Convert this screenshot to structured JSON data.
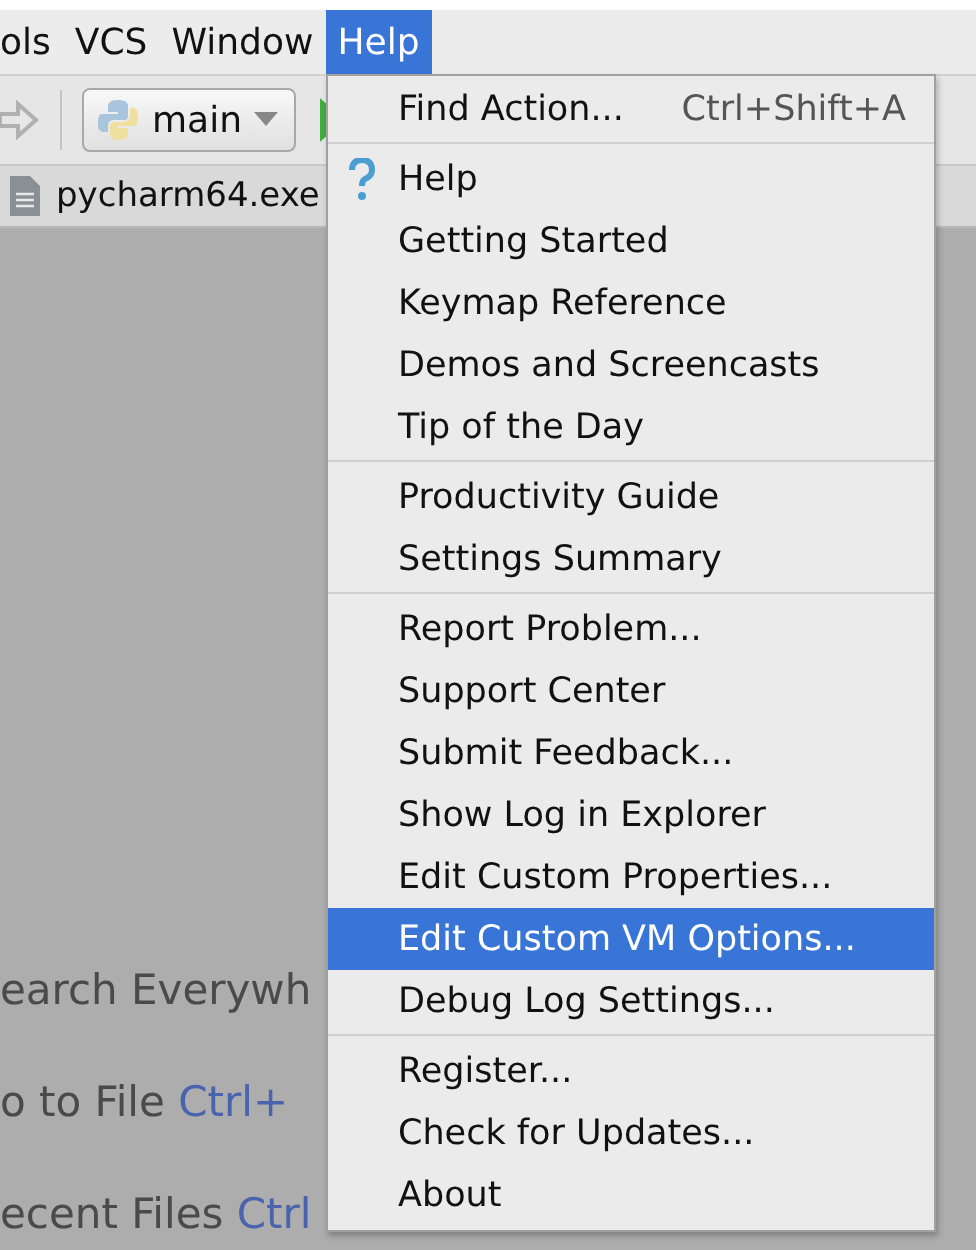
{
  "menu_bar": [
    {
      "label": "ols",
      "selected": false
    },
    {
      "label": "VCS",
      "selected": false
    },
    {
      "label": "Window",
      "selected": false
    },
    {
      "label": "Help",
      "selected": true
    }
  ],
  "toolbar": {
    "configuration": "main"
  },
  "editor_tab": {
    "label": "pycharm64.exe"
  },
  "editor_hints": [
    {
      "label": "earch Everywh"
    },
    {
      "label": "o to File",
      "shortcut": "Ctrl+"
    },
    {
      "label": "ecent Files",
      "shortcut": "Ctrl"
    }
  ],
  "help_menu": {
    "groups": [
      [
        {
          "kind": "plain",
          "label": "Find Action...",
          "shortcut": "Ctrl+Shift+A",
          "selected": false
        }
      ],
      [
        {
          "kind": "help",
          "label": "Help",
          "selected": false
        },
        {
          "kind": "plain",
          "label": "Getting Started",
          "selected": false
        },
        {
          "kind": "plain",
          "label": "Keymap Reference",
          "selected": false
        },
        {
          "kind": "plain",
          "label": "Demos and Screencasts",
          "selected": false
        },
        {
          "kind": "plain",
          "label": "Tip of the Day",
          "selected": false
        }
      ],
      [
        {
          "kind": "plain",
          "label": "Productivity Guide",
          "selected": false
        },
        {
          "kind": "plain",
          "label": "Settings Summary",
          "selected": false
        }
      ],
      [
        {
          "kind": "plain",
          "label": "Report Problem...",
          "selected": false
        },
        {
          "kind": "plain",
          "label": "Support Center",
          "selected": false
        },
        {
          "kind": "plain",
          "label": "Submit Feedback...",
          "selected": false
        },
        {
          "kind": "plain",
          "label": "Show Log in Explorer",
          "selected": false
        },
        {
          "kind": "plain",
          "label": "Edit Custom Properties...",
          "selected": false
        },
        {
          "kind": "plain",
          "label": "Edit Custom VM Options...",
          "selected": true
        },
        {
          "kind": "plain",
          "label": "Debug Log Settings...",
          "selected": false
        }
      ],
      [
        {
          "kind": "plain",
          "label": "Register...",
          "selected": false
        },
        {
          "kind": "plain",
          "label": "Check for Updates...",
          "selected": false
        },
        {
          "kind": "plain",
          "label": "About",
          "selected": false
        }
      ]
    ]
  }
}
